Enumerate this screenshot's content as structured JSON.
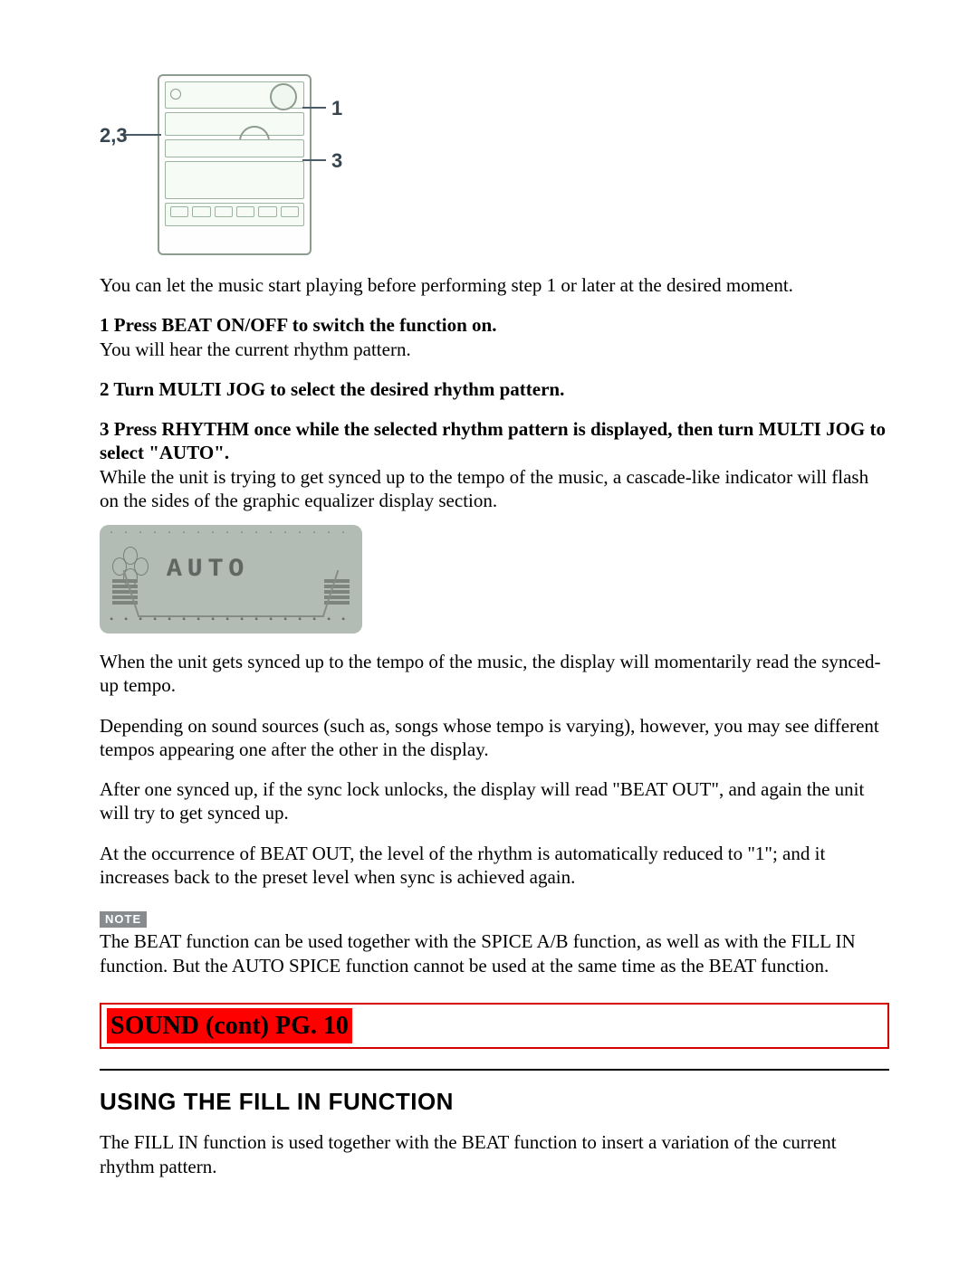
{
  "diagram": {
    "callout_1": "1",
    "callout_23": "2,3",
    "callout_3": "3"
  },
  "intro": "You can let the music start playing before performing step 1 or later at the desired moment.",
  "step1": {
    "head": "1 Press BEAT ON/OFF to switch the function on.",
    "body": "You will hear the current rhythm pattern."
  },
  "step2_head": "2 Turn MULTI JOG to select the desired rhythm pattern.",
  "step3": {
    "head": "3 Press RHYTHM once while the selected rhythm pattern is displayed, then turn MULTI JOG to select \"AUTO\".",
    "body": "While the unit is trying to get synced up to the tempo of the music, a cascade-like indicator will flash on the sides of the graphic equalizer display section."
  },
  "auto_display_text": "AUTO",
  "p_sync": "When the unit gets synced up to the tempo of the music, the display will momentarily read the synced-up tempo.",
  "p_vary": "Depending on sound sources (such as, songs whose tempo is varying), however, you may see different tempos appearing one after the other in the display.",
  "p_beatout1": "After one synced up, if the sync lock unlocks, the display will read \"BEAT OUT\", and again the unit will try to get synced up.",
  "p_beatout2": "At the occurrence of BEAT OUT, the level of the rhythm is automatically reduced to \"1\"; and it increases back to the preset level when sync is achieved again.",
  "note": {
    "label": "NOTE",
    "text": "The BEAT function can be used together with the SPICE A/B function, as well as with the FILL IN function. But the AUTO SPICE function cannot be used at the same time as the BEAT function."
  },
  "banner": "SOUND (cont)  PG. 10",
  "h2": "USING THE FILL IN FUNCTION",
  "p_fillin": "The FILL IN function is used together with the BEAT function to insert a variation of the current rhythm pattern."
}
